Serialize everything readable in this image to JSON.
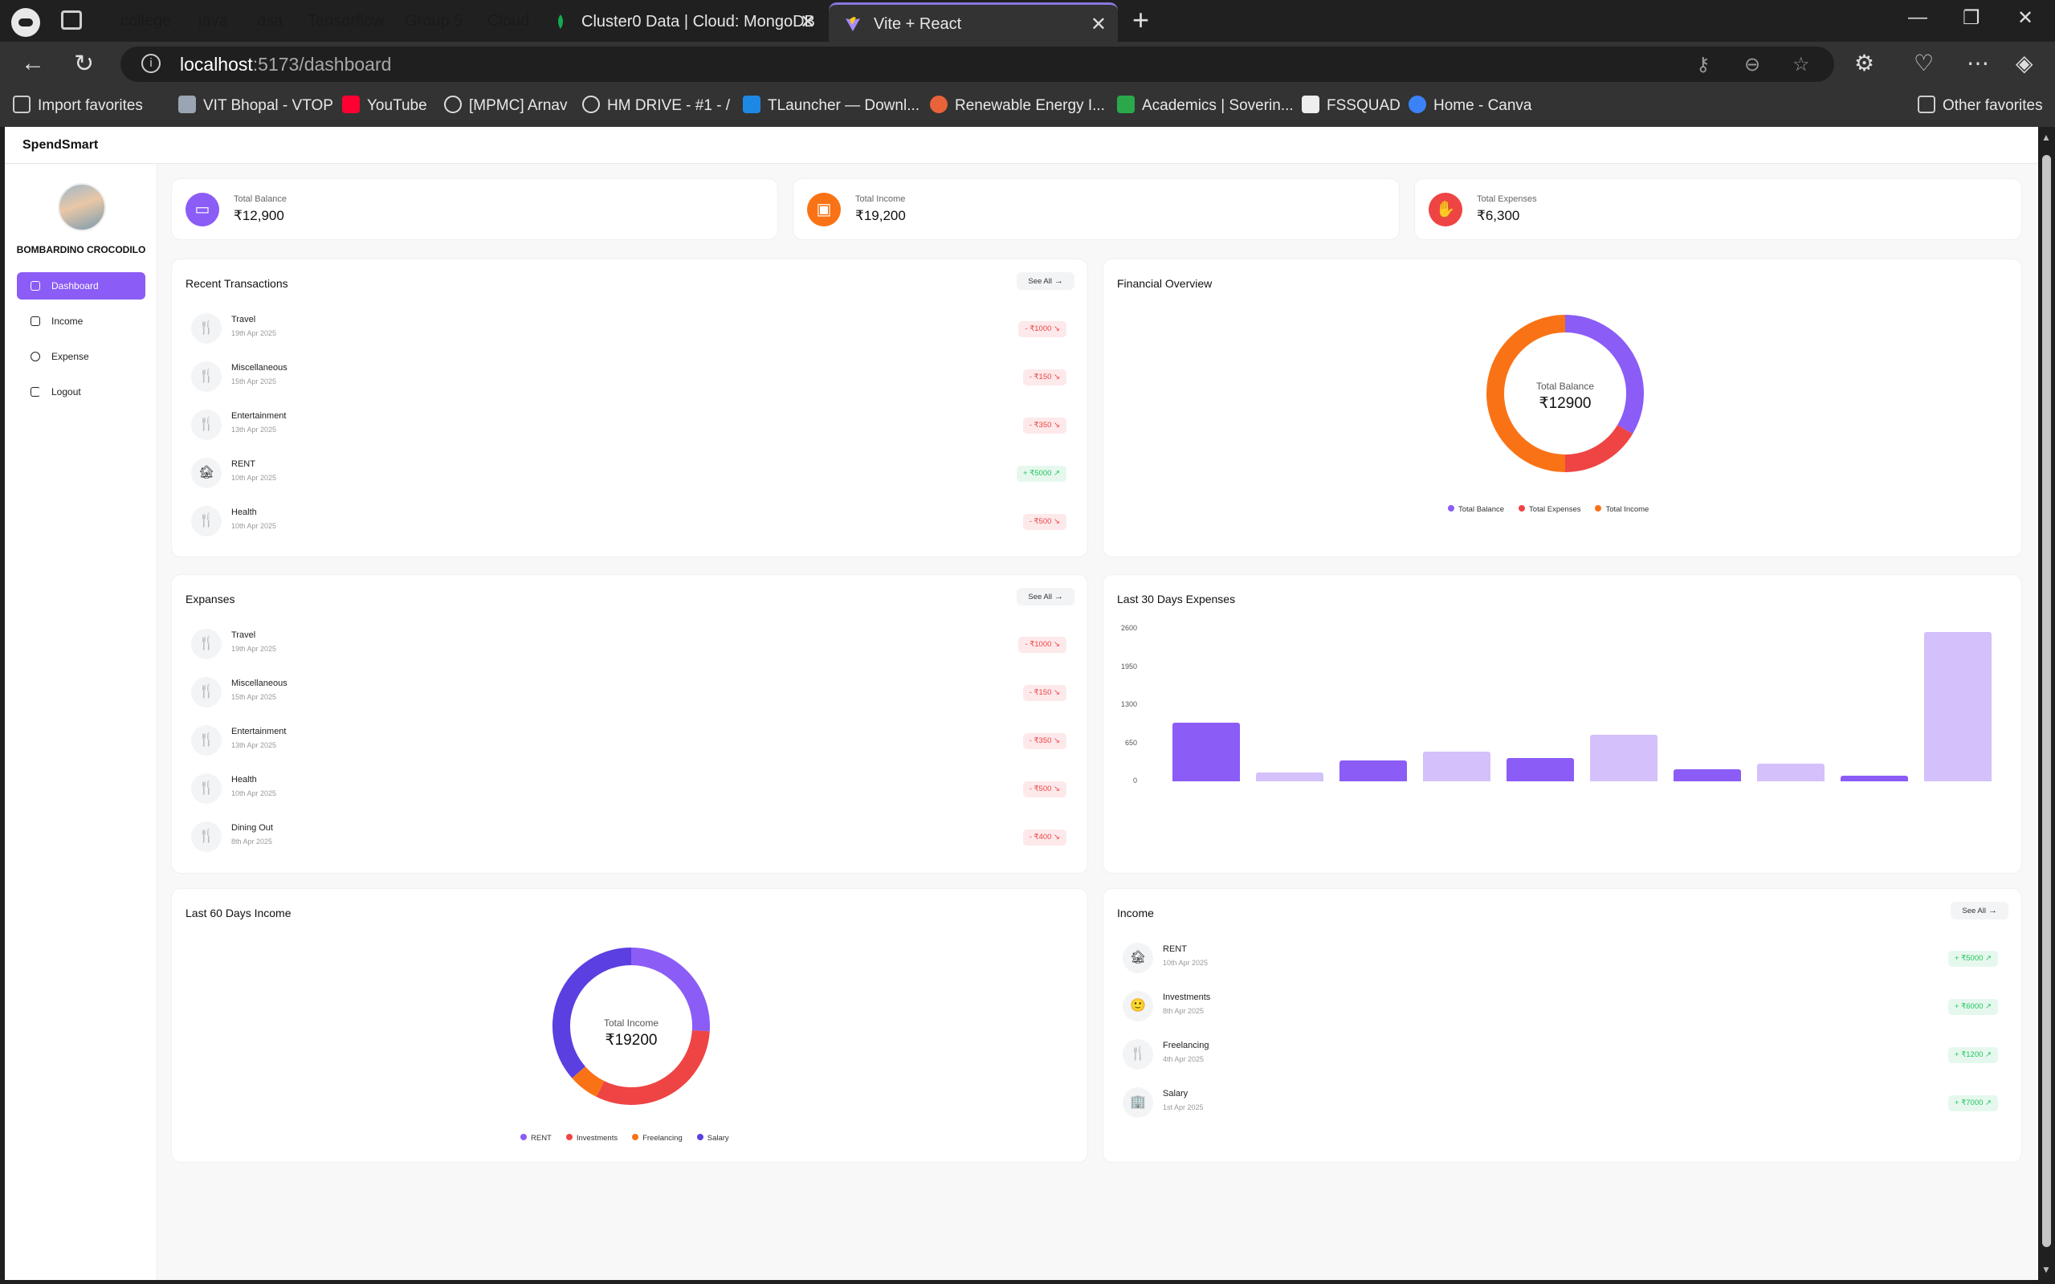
{
  "browser": {
    "tab_groups": [
      {
        "label": "college",
        "color": "#5b9cf5"
      },
      {
        "label": "java",
        "color": "#d9b84d"
      },
      {
        "label": "dsa",
        "color": "#39b6b0"
      },
      {
        "label": "Tensorflow",
        "color": "#e86ad0"
      },
      {
        "label": "Group 5",
        "color": "#f06aa6"
      },
      {
        "label": "Cloud",
        "color": "#a98cf6"
      }
    ],
    "tabs": [
      {
        "title": "Cluster0 Data | Cloud: MongoDB C",
        "active": false
      },
      {
        "title": "Vite + React",
        "active": true
      }
    ],
    "url_host": "localhost",
    "url_path": ":5173/dashboard",
    "bookmarks": [
      {
        "label": "Import favorites",
        "icon": "import-icon"
      },
      {
        "label": "VIT Bhopal - VTOP",
        "icon": "vtop-icon"
      },
      {
        "label": "YouTube",
        "icon": "youtube-icon"
      },
      {
        "label": "[MPMC] Arnav",
        "icon": "chatgpt-icon"
      },
      {
        "label": "HM DRIVE - #1 - /",
        "icon": "globe-icon"
      },
      {
        "label": "TLauncher — Downl...",
        "icon": "tlauncher-icon"
      },
      {
        "label": "Renewable Energy I...",
        "icon": "sunburst-icon"
      },
      {
        "label": "Academics | Soverin...",
        "icon": "leaf-icon"
      },
      {
        "label": "FSSQUAD",
        "icon": "fssquad-icon"
      },
      {
        "label": "Home - Canva",
        "icon": "canva-icon"
      }
    ],
    "other_favorites": "Other favorites"
  },
  "app": {
    "brand": "SpendSmart",
    "user_name": "BOMBARDINO CROCODILO",
    "menu": [
      {
        "label": "Dashboard",
        "active": true,
        "icon": "dashboard-icon"
      },
      {
        "label": "Income",
        "active": false,
        "icon": "income-icon"
      },
      {
        "label": "Expense",
        "active": false,
        "icon": "expense-icon"
      },
      {
        "label": "Logout",
        "active": false,
        "icon": "logout-icon"
      }
    ],
    "stats": [
      {
        "label": "Total Balance",
        "value": "₹12,900",
        "color": "#8b5cf6",
        "icon": "card-icon"
      },
      {
        "label": "Total Income",
        "value": "₹19,200",
        "color": "#f97316",
        "icon": "wallet-icon"
      },
      {
        "label": "Total Expenses",
        "value": "₹6,300",
        "color": "#ef4444",
        "icon": "hand-coins-icon"
      }
    ],
    "see_all": "See All",
    "recent_transactions": {
      "title": "Recent Transactions",
      "items": [
        {
          "name": "Travel",
          "date": "19th Apr 2025",
          "amount": "- ₹1000",
          "type": "neg",
          "icon": "fork-knife-icon"
        },
        {
          "name": "Miscellaneous",
          "date": "15th Apr 2025",
          "amount": "- ₹150",
          "type": "neg",
          "icon": "fork-knife-icon"
        },
        {
          "name": "Entertainment",
          "date": "13th Apr 2025",
          "amount": "- ₹350",
          "type": "neg",
          "icon": "fork-knife-icon"
        },
        {
          "name": "RENT",
          "date": "10th Apr 2025",
          "amount": "+ ₹5000",
          "type": "pos",
          "icon": "house-icon"
        },
        {
          "name": "Health",
          "date": "10th Apr 2025",
          "amount": "- ₹500",
          "type": "neg",
          "icon": "fork-knife-icon"
        }
      ]
    },
    "financial_overview": {
      "title": "Financial Overview",
      "center_label": "Total Balance",
      "center_value": "₹12900"
    },
    "expenses": {
      "title": "Expanses",
      "items": [
        {
          "name": "Travel",
          "date": "19th Apr 2025",
          "amount": "- ₹1000",
          "type": "neg",
          "icon": "fork-knife-icon"
        },
        {
          "name": "Miscellaneous",
          "date": "15th Apr 2025",
          "amount": "- ₹150",
          "type": "neg",
          "icon": "fork-knife-icon"
        },
        {
          "name": "Entertainment",
          "date": "13th Apr 2025",
          "amount": "- ₹350",
          "type": "neg",
          "icon": "fork-knife-icon"
        },
        {
          "name": "Health",
          "date": "10th Apr 2025",
          "amount": "- ₹500",
          "type": "neg",
          "icon": "fork-knife-icon"
        },
        {
          "name": "Dining Out",
          "date": "8th Apr 2025",
          "amount": "- ₹400",
          "type": "neg",
          "icon": "fork-knife-icon"
        }
      ]
    },
    "last30": {
      "title": "Last 30 Days Expenses"
    },
    "last60": {
      "title": "Last 60 Days Income",
      "center_label": "Total Income",
      "center_value": "₹19200"
    },
    "income": {
      "title": "Income",
      "items": [
        {
          "name": "RENT",
          "date": "10th Apr 2025",
          "amount": "+ ₹5000",
          "type": "pos",
          "icon": "house-icon"
        },
        {
          "name": "Investments",
          "date": "8th Apr 2025",
          "amount": "+ ₹6000",
          "type": "pos",
          "icon": "smiley-icon"
        },
        {
          "name": "Freelancing",
          "date": "4th Apr 2025",
          "amount": "+ ₹1200",
          "type": "pos",
          "icon": "fork-knife-icon"
        },
        {
          "name": "Salary",
          "date": "1st Apr 2025",
          "amount": "+ ₹7000",
          "type": "pos",
          "icon": "building-icon"
        }
      ]
    }
  },
  "chart_data": [
    {
      "type": "pie",
      "variant": "donut",
      "categories": [
        "Total Balance",
        "Total Expenses",
        "Total Income"
      ],
      "values": [
        12900,
        6300,
        19200
      ],
      "colors": [
        "#8b5cf6",
        "#ef4444",
        "#f97316"
      ],
      "legend": "bottom"
    },
    {
      "type": "bar",
      "title": "Last 30 Days Expenses",
      "categories": [
        "",
        "",
        "",
        "",
        "",
        "",
        "",
        "",
        "",
        ""
      ],
      "values": [
        1000,
        150,
        350,
        500,
        400,
        800,
        200,
        300,
        100,
        2550
      ],
      "yticks": [
        0,
        650,
        1300,
        1950,
        2600
      ],
      "ylim": [
        0,
        2600
      ],
      "colors": [
        "#8b5cf6",
        "#d4c0fb"
      ],
      "grid": false
    },
    {
      "type": "pie",
      "variant": "donut",
      "categories": [
        "RENT",
        "Investments",
        "Freelancing",
        "Salary"
      ],
      "values": [
        5000,
        6000,
        1200,
        7000
      ],
      "colors": [
        "#8b5cf6",
        "#ef4444",
        "#f97316",
        "#5b3fe0"
      ],
      "legend": "bottom"
    }
  ]
}
